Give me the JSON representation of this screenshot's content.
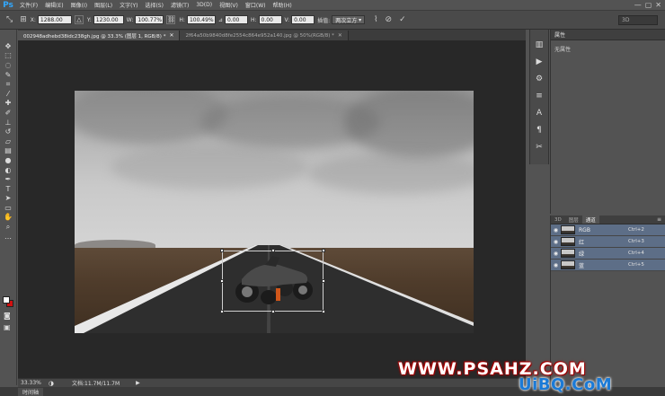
{
  "app": {
    "logo": "Ps"
  },
  "menu": [
    "文件(F)",
    "编辑(E)",
    "图像(I)",
    "图层(L)",
    "文字(Y)",
    "选择(S)",
    "滤镜(T)",
    "3D(D)",
    "视图(V)",
    "窗口(W)",
    "帮助(H)"
  ],
  "window_controls": {
    "minimize": "—",
    "maximize": "▢",
    "close": "✕"
  },
  "options": {
    "x_label": "X:",
    "x_value": "1288.00",
    "y_label": "Y:",
    "y_value": "1230.00",
    "w_label": "W:",
    "w_value": "100.77%",
    "h_label": "H:",
    "h_value": "100.49%",
    "angle_value": "0.00",
    "hskew_label": "H:",
    "hskew_value": "0.00",
    "vskew_label": "V:",
    "vskew_value": "0.00",
    "interp_label": "插值:",
    "interp_value": "两次立方",
    "right_field": "3D"
  },
  "doc_tabs": [
    {
      "label": "002948adhebd38idc238gh.jpg @ 33.3% (图层 1, RGB/8) *",
      "active": true
    },
    {
      "label": "2f64a50b9840d8fe2554c864e952a140.jpg @ 50%(RGB/8) *",
      "active": false
    }
  ],
  "status": {
    "zoom": "33.33%",
    "doc": "文档:11.7M/11.7M"
  },
  "bottom_tab": "时间轴",
  "properties": {
    "title": "属性",
    "body": "无属性"
  },
  "layers_panel": {
    "tabs": [
      {
        "label": "3D",
        "active": false
      },
      {
        "label": "图层",
        "active": false
      },
      {
        "label": "通道",
        "active": true
      }
    ],
    "channels": [
      {
        "name": "RGB",
        "key": "Ctrl+2"
      },
      {
        "name": "红",
        "key": "Ctrl+3"
      },
      {
        "name": "绿",
        "key": "Ctrl+4"
      },
      {
        "name": "蓝",
        "key": "Ctrl+5"
      }
    ]
  },
  "watermark": {
    "main": "WWW.PSAHZ.COM",
    "secondary": "UiBQ.CoM"
  },
  "colors": {
    "foreground": "#ffffff",
    "background": "#d01010",
    "accent": "#31a8ff"
  }
}
